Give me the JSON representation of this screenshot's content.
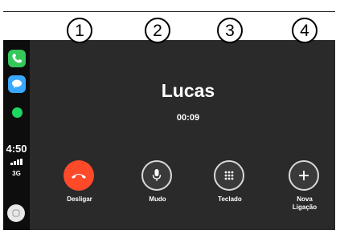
{
  "call": {
    "caller_name": "Lucas",
    "duration": "00:09"
  },
  "status_bar": {
    "time": "4:50",
    "network": "3G"
  },
  "sidebar": {
    "apps": [
      {
        "icon": "phone-icon",
        "color": "#34c759"
      },
      {
        "icon": "messages-icon",
        "color": "#3aa8ff"
      },
      {
        "icon": "spotify-icon",
        "color": "#1ed760"
      }
    ]
  },
  "controls": [
    {
      "callout": "1",
      "label": "Desligar",
      "icon": "end-call-icon",
      "color": "#ff4a2a"
    },
    {
      "callout": "2",
      "label": "Mudo",
      "icon": "microphone-icon"
    },
    {
      "callout": "3",
      "label": "Teclado",
      "icon": "keypad-icon"
    },
    {
      "callout": "4",
      "label_line1": "Nova",
      "label_line2": "Ligação",
      "icon": "plus-icon"
    }
  ]
}
